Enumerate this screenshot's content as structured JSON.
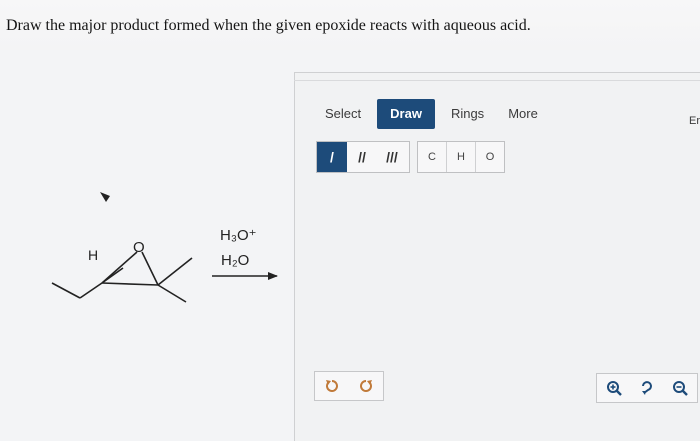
{
  "question": "Draw the major product formed when the given epoxide reacts with aqueous acid.",
  "reaction": {
    "reagent_top": "H₃O⁺",
    "reagent_bottom": "H₂O",
    "atom_h": "H",
    "atom_o": "O"
  },
  "editor": {
    "tabs": [
      "Select",
      "Draw",
      "Rings",
      "More"
    ],
    "active_tab": "Draw",
    "tab_end_fragment": "Er",
    "bond_tools": [
      "/",
      "//",
      "///"
    ],
    "atom_tools": [
      "C",
      "H",
      "O"
    ],
    "history": [
      "undo-icon",
      "redo-icon"
    ],
    "zoom": [
      "zoom-in-icon",
      "reset-zoom-icon",
      "zoom-out-icon"
    ]
  },
  "colors": {
    "accent": "#1d4b7a",
    "history_icon": "#c07a3a"
  }
}
